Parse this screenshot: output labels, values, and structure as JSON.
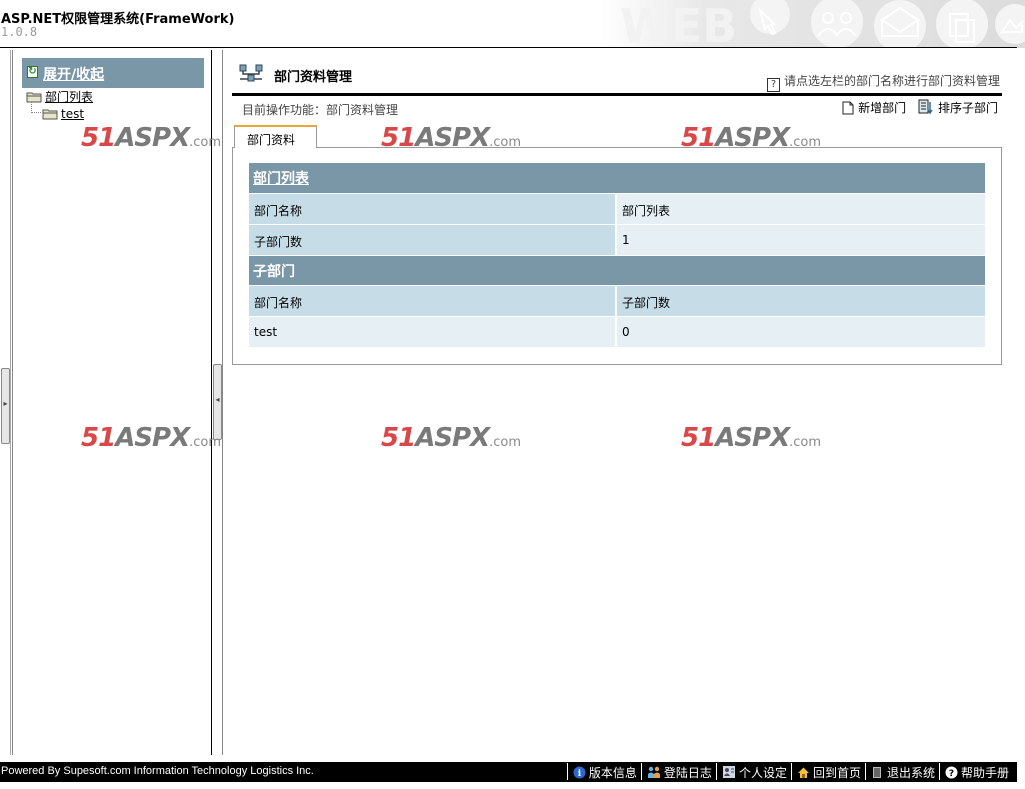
{
  "header": {
    "title": "ASP.NET权限管理系统(FrameWork)",
    "version": "1.0.8"
  },
  "sidebar": {
    "toggle_label": "展开/收起",
    "tree": {
      "root": "部门列表",
      "children": [
        "test"
      ]
    }
  },
  "main": {
    "page_title": "部门资料管理",
    "hint": "请点选左栏的部门名称进行部门资料管理",
    "current_op": "目前操作功能：部门资料管理",
    "toolbar": {
      "add_label": "新增部门",
      "sort_label": "排序子部门"
    },
    "tab_label": "部门资料",
    "dept_list": {
      "header": "部门列表",
      "rows": [
        {
          "label": "部门名称",
          "value": "部门列表"
        },
        {
          "label": "子部门数",
          "value": "1"
        }
      ]
    },
    "sub_depts": {
      "header": "子部门",
      "columns": [
        "部门名称",
        "子部门数"
      ],
      "rows": [
        {
          "name": "test",
          "count": "0"
        }
      ]
    }
  },
  "watermark": {
    "part1": "51",
    "part2": "ASPX",
    "part3": ".com"
  },
  "footer": {
    "powered": "Powered By Supesoft.com Information Technology Logistics Inc.",
    "links": [
      "版本信息",
      "登陆日志",
      "个人设定",
      "回到首页",
      "退出系统",
      "帮助手册"
    ]
  },
  "colors": {
    "section_header": "#7a97a8",
    "row_dark": "#c6dde7",
    "row_light": "#e5eff4",
    "tab_accent": "#e8a838",
    "watermark_red": "#d84848"
  }
}
